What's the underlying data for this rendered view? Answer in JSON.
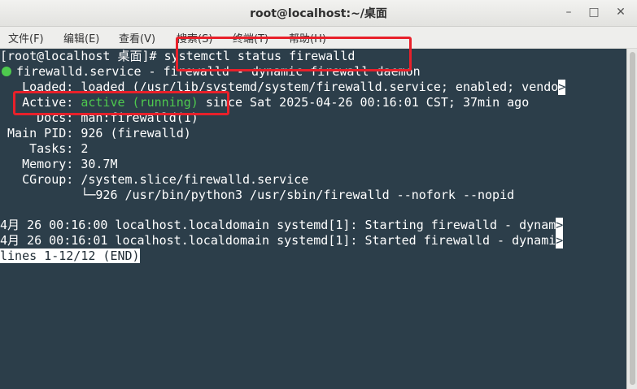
{
  "window": {
    "title": "root@localhost:~/桌面",
    "min": "–",
    "max": "□",
    "close": "✕"
  },
  "menu": [
    "文件(F)",
    "编辑(E)",
    "查看(V)",
    "搜索(S)",
    "终端(T)",
    "帮助(H)"
  ],
  "terminal": {
    "prompt": "[root@localhost 桌面]#",
    "command": " systemctl status firewalld",
    "service_line": "firewalld.service - firewalld - dynamic firewall daemon",
    "loaded": "   Loaded: loaded (/usr/lib/systemd/system/firewalld.service; enabled; vendo",
    "active_label": "   Active: ",
    "active_state": "active (running)",
    "active_rest": " since Sat 2025-04-26 00:16:01 CST; 37min ago",
    "docs": "     Docs: man:firewalld(1)",
    "pid": " Main PID: 926 (firewalld)",
    "tasks": "    Tasks: 2",
    "memory": "   Memory: 30.7M",
    "cgroup": "   CGroup: /system.slice/firewalld.service",
    "cgroup_child": "           └─926 /usr/bin/python3 /usr/sbin/firewalld --nofork --nopid",
    "log1": "4月 26 00:16:00 localhost.localdomain systemd[1]: Starting firewalld - dynam",
    "log2": "4月 26 00:16:01 localhost.localdomain systemd[1]: Started firewalld - dynami",
    "truncation_mark": ">",
    "pager_status": "lines 1-12/12 (END)"
  },
  "colors": {
    "terminal_bg": "#2c3e4a",
    "active_green": "#4ec94e",
    "highlight_red": "#e8202a"
  }
}
